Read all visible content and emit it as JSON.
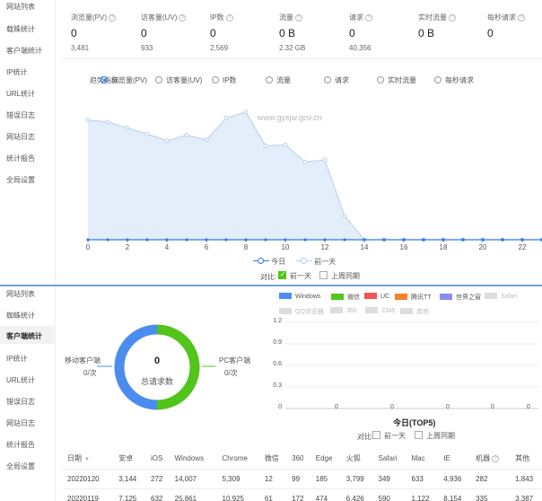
{
  "sidebar_top": {
    "items": [
      {
        "label": "网站列表"
      },
      {
        "label": "载蛛统计"
      },
      {
        "label": "客户端统计"
      },
      {
        "label": "IP统计"
      },
      {
        "label": "URL统计"
      },
      {
        "label": "错误日志"
      },
      {
        "label": "网站日志"
      },
      {
        "label": "统计报告"
      },
      {
        "label": "全局设置"
      }
    ]
  },
  "stats": {
    "items": [
      {
        "label": "浏览量(PV)",
        "value": "0",
        "sub": "3,481"
      },
      {
        "label": "访客量(UV)",
        "value": "0",
        "sub": "933"
      },
      {
        "label": "IP数",
        "value": "0",
        "sub": "2,569"
      },
      {
        "label": "流量",
        "value": "0 B",
        "sub": "2.32 GB"
      },
      {
        "label": "请求",
        "value": "0",
        "sub": "40,356"
      },
      {
        "label": "实时流量",
        "value": "0 B",
        "sub": ""
      },
      {
        "label": "每秒请求",
        "value": "0",
        "sub": ""
      }
    ]
  },
  "metric_selector": {
    "label": "趋势指标:",
    "options": [
      {
        "label": "浏览量(PV)",
        "checked": true
      },
      {
        "label": "访客量(UV)",
        "checked": false
      },
      {
        "label": "IP数",
        "checked": false
      },
      {
        "label": "流量",
        "checked": false
      },
      {
        "label": "请求",
        "checked": false
      },
      {
        "label": "实时流量",
        "checked": false
      },
      {
        "label": "每秒请求",
        "checked": false
      }
    ]
  },
  "chart_data": [
    {
      "type": "area",
      "watermark": "www.gysjw.gov.cn",
      "x": [
        0,
        1,
        2,
        3,
        4,
        5,
        6,
        7,
        8,
        9,
        10,
        11,
        12,
        13,
        14,
        15,
        16,
        17,
        18,
        19,
        20,
        21,
        22,
        23
      ],
      "xticks": [
        "0",
        "2",
        "4",
        "6",
        "8",
        "10",
        "12",
        "14",
        "16",
        "18",
        "20",
        "22"
      ],
      "series": [
        {
          "name": "今日",
          "color": "#2b7de9",
          "values": [
            0,
            0,
            0,
            0,
            0,
            0,
            0,
            0,
            0,
            0,
            0,
            0,
            0,
            0,
            0,
            0,
            0,
            0,
            0,
            0,
            0,
            0,
            0,
            0
          ]
        },
        {
          "name": "前一天",
          "color": "#c7dcf2",
          "values": [
            300,
            295,
            280,
            265,
            248,
            262,
            250,
            305,
            320,
            235,
            238,
            195,
            200,
            60,
            0,
            0,
            0,
            0,
            0,
            0,
            0,
            0,
            0,
            0
          ]
        }
      ],
      "ylim": [
        0,
        360
      ],
      "legend": [
        "今日",
        "前一天"
      ],
      "compare_label": "对比:",
      "compare_options": [
        {
          "label": "前一天",
          "checked": true
        },
        {
          "label": "上周同期",
          "checked": false
        }
      ]
    },
    {
      "type": "pie",
      "title": "0",
      "subtitle": "总请求数",
      "slices": [
        {
          "name": "移动客户端",
          "value": "0/次",
          "color": "#4a8cf0"
        },
        {
          "name": "PC客户端",
          "value": "0/次",
          "color": "#52c41a"
        }
      ]
    },
    {
      "type": "bar",
      "title": "今日(TOP5)",
      "legend": [
        {
          "name": "Windows",
          "color": "#4a8cf0",
          "active": true
        },
        {
          "name": "微信",
          "color": "#52c41a",
          "active": true
        },
        {
          "name": "UC",
          "color": "#f05555",
          "active": true
        },
        {
          "name": "腾讯TT",
          "color": "#f5832b",
          "active": true
        },
        {
          "name": "世界之窗",
          "color": "#8b8bf5",
          "active": true
        },
        {
          "name": "Safari",
          "color": "#cccccc",
          "active": false
        },
        {
          "name": "QQ浏览器",
          "color": "#cccccc",
          "active": false
        },
        {
          "name": "360",
          "color": "#cccccc",
          "active": false
        },
        {
          "name": "2345",
          "color": "#cccccc",
          "active": false
        },
        {
          "name": "其他",
          "color": "#cccccc",
          "active": false
        }
      ],
      "yticks": [
        "1.2",
        "0.9",
        "0.6",
        "0.3",
        "0"
      ],
      "ylim": [
        0,
        1.2
      ],
      "values": [
        0,
        0,
        0,
        0,
        0
      ],
      "value_labels": [
        "0",
        "0",
        "0",
        "0",
        "0"
      ],
      "compare_label": "对比:",
      "compare_options": [
        {
          "label": "前一天",
          "checked": false
        },
        {
          "label": "上周同期",
          "checked": false
        }
      ]
    }
  ],
  "sidebar_bottom": {
    "items": [
      {
        "label": "网站列表"
      },
      {
        "label": "蜘蛛统计"
      },
      {
        "label": "客户端统计",
        "active": true
      },
      {
        "label": "IP统计"
      },
      {
        "label": "URL统计"
      },
      {
        "label": "错误日志"
      },
      {
        "label": "网站日志"
      },
      {
        "label": "统计报告"
      },
      {
        "label": "全局设置"
      }
    ]
  },
  "table": {
    "columns": [
      "日期",
      "安卓",
      "iOS",
      "Windows",
      "Chrome",
      "微信",
      "360",
      "Edge",
      "火狐",
      "Safari",
      "Mac",
      "IE",
      "机器",
      "其他"
    ],
    "rows": [
      [
        "20220120",
        "3,144",
        "272",
        "14,007",
        "5,309",
        "12",
        "99",
        "185",
        "3,799",
        "349",
        "633",
        "4,936",
        "282",
        "1,843"
      ],
      [
        "20220119",
        "7,125",
        "632",
        "25,861",
        "10,925",
        "61",
        "172",
        "474",
        "6,426",
        "590",
        "1,122",
        "8,154",
        "335",
        "3,387"
      ]
    ]
  }
}
